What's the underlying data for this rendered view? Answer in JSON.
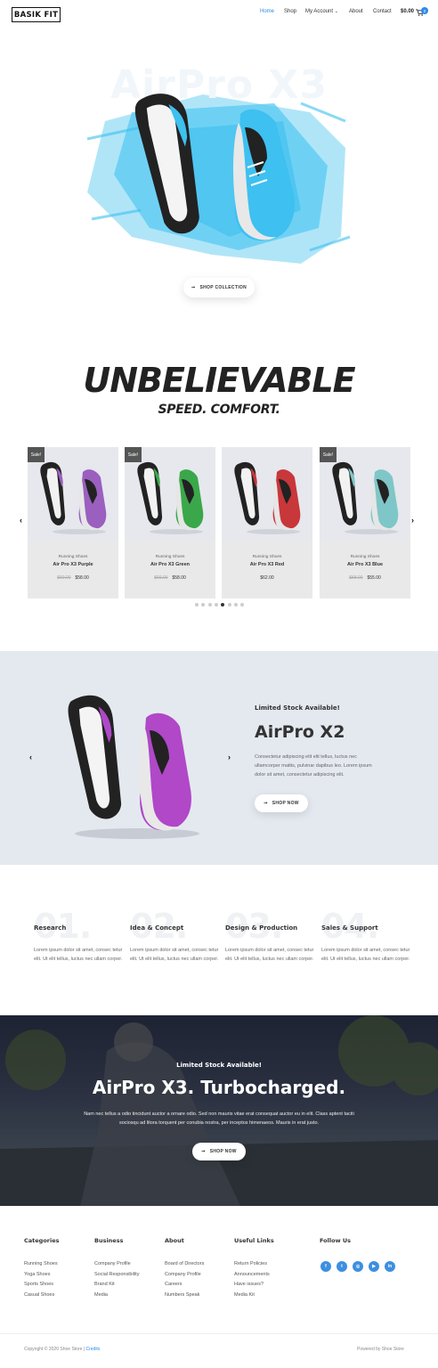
{
  "header": {
    "logo": "BASIK FIT",
    "nav": [
      "Home",
      "Shop",
      "My Account",
      "About",
      "Contact"
    ],
    "active": "Home",
    "cart_total": "$0.00",
    "cart_count": "0"
  },
  "hero": {
    "title": "AirPro X3",
    "cta_label": "SHOP COLLECTION"
  },
  "tagline": {
    "title": "UNBELIEVABLE",
    "subtitle": "SPEED. COMFORT."
  },
  "products": [
    {
      "sale": "Sale!",
      "category": "Running Shoes",
      "name": "Air Pro X3 Purple",
      "old_price": "$60.00",
      "price": "$58.00",
      "color": "#9b5fc0"
    },
    {
      "sale": "Sale!",
      "category": "Running Shoes",
      "name": "Air Pro X3 Green",
      "old_price": "$60.00",
      "price": "$58.00",
      "color": "#3aa84a"
    },
    {
      "sale": "",
      "category": "Running Shoes",
      "name": "Air Pro X3 Red",
      "old_price": "",
      "price": "$62.00",
      "color": "#c8373a"
    },
    {
      "sale": "Sale!",
      "category": "Running Shoes",
      "name": "Air Pro X3 Blue",
      "old_price": "$58.00",
      "price": "$55.00",
      "color": "#7fc6c8"
    }
  ],
  "carousel": {
    "dots": 8,
    "active": 4
  },
  "promo": {
    "eyebrow": "Limited Stock Available!",
    "title": "AirPro X2",
    "description": "Consectetur adipiscing elit elit tellus, luctus nec ullamcorper mattis, pulvinar dapibus leo. Lorem ipsum dolor sit amet, consectetur adipiscing elit.",
    "cta_label": "SHOP NOW"
  },
  "steps": [
    {
      "num": "01.",
      "title": "Research",
      "desc": "Lorem ipsum dolor sit amet, consec tetur elit. Ut elit tellus, luctus nec ullam corper."
    },
    {
      "num": "02.",
      "title": "Idea & Concept",
      "desc": "Lorem ipsum dolor sit amet, consec tetur elit. Ut elit tellus, luctus nec ullam corper."
    },
    {
      "num": "03.",
      "title": "Design & Production",
      "desc": "Lorem ipsum dolor sit amet, consec tetur elit. Ut elit tellus, luctus nec ullam corper."
    },
    {
      "num": "04.",
      "title": "Sales & Support",
      "desc": "Lorem ipsum dolor sit amet, consec tetur elit. Ut elit tellus, luctus nec ullam corper."
    }
  ],
  "cta": {
    "eyebrow": "Limited Stock Available!",
    "title": "AirPro X3. Turbocharged.",
    "description": "Nam nec tellus a odio tincidunt auctor a ornare odio. Sed non mauris vitae erat consequat auctor eu in elit. Class aptent taciti sociosqu ad litora torquent per conubia nostra, per inceptos himenaeos. Mauris in erat justo.",
    "cta_label": "SHOP NOW"
  },
  "footer": {
    "columns": [
      {
        "heading": "Categories",
        "links": [
          "Running Shoes",
          "Yoga Shoes",
          "Sports Shoes",
          "Casual Shoes"
        ]
      },
      {
        "heading": "Business",
        "links": [
          "Company Profile",
          "Social Responsibility",
          "Brand Kit",
          "Media"
        ]
      },
      {
        "heading": "About",
        "links": [
          "Board of Directors",
          "Company Profile",
          "Careers",
          "Numbers Speak"
        ]
      },
      {
        "heading": "Useful Links",
        "links": [
          "Return Policies",
          "Announcements",
          "Have issues?",
          "Media Kit"
        ]
      }
    ],
    "follow_heading": "Follow Us",
    "social_icons": [
      "facebook-icon",
      "twitter-icon",
      "instagram-icon",
      "youtube-icon",
      "linkedin-icon"
    ],
    "social_glyphs": [
      "f",
      "t",
      "◎",
      "▶",
      "in"
    ],
    "copyright": "Copyright © 2020 Shoe Store |",
    "credits": "Credits",
    "powered": "Powered by Shoe Store"
  },
  "colors": {
    "accent": "#2a8ce8",
    "hero_splash": "#3ec0f0",
    "promo_bg": "#e4e9f0"
  }
}
